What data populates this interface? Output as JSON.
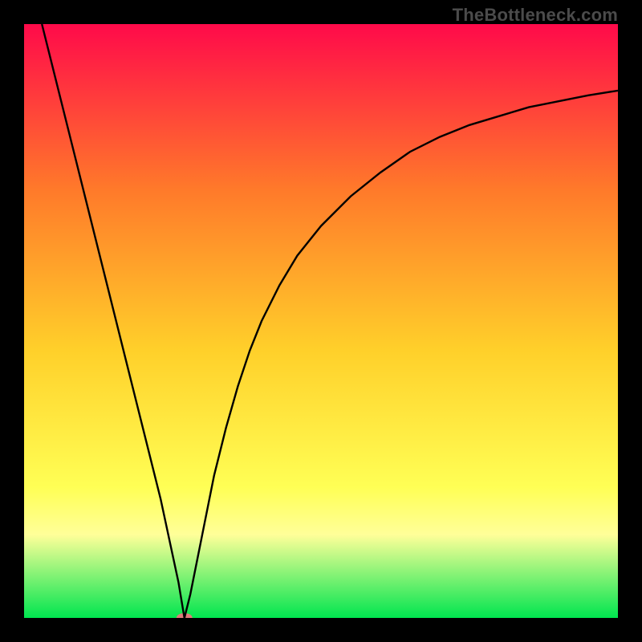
{
  "watermark": {
    "text": "TheBottleneck.com"
  },
  "chart_data": {
    "type": "line",
    "title": "",
    "xlabel": "",
    "ylabel": "",
    "xlim": [
      0,
      100
    ],
    "ylim": [
      0,
      100
    ],
    "grid": false,
    "legend": false,
    "background_gradient": {
      "top": "#ff0a4a",
      "mid1": "#ff7a2a",
      "mid2": "#ffd02a",
      "mid3": "#ffff55",
      "band": "#ffff99",
      "bottom": "#00e54f",
      "stops_pct": [
        0,
        28,
        55,
        78,
        86,
        100
      ]
    },
    "optimal_x": 27,
    "marker": {
      "x": 27,
      "y": 0,
      "color": "#e07a7a",
      "rx": 10,
      "ry": 6
    },
    "series": [
      {
        "name": "curve",
        "color": "#000000",
        "width": 2.4,
        "x": [
          3,
          5,
          8,
          11,
          14,
          17,
          20,
          23,
          26,
          27,
          28,
          30,
          32,
          34,
          36,
          38,
          40,
          43,
          46,
          50,
          55,
          60,
          65,
          70,
          75,
          80,
          85,
          90,
          95,
          100
        ],
        "y": [
          100,
          92,
          80,
          68,
          56,
          44,
          32,
          20,
          6,
          0,
          4,
          14,
          24,
          32,
          39,
          45,
          50,
          56,
          61,
          66,
          71,
          75,
          78.5,
          81,
          83,
          84.5,
          86,
          87,
          88,
          88.8
        ]
      }
    ]
  }
}
